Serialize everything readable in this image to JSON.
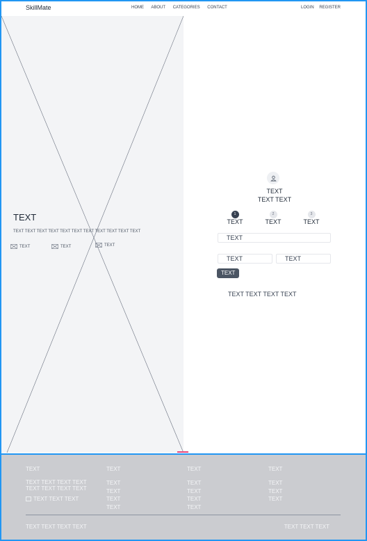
{
  "nav": {
    "brand": "SkillMate",
    "links": [
      "HOME",
      "ABOUT",
      "CATEGORIES",
      "CONTACT"
    ],
    "login": "LOGIN",
    "register": "REGISTER"
  },
  "hero": {
    "title": "TEXT",
    "subtitle": "TEXT TEXT TEXT TEXT TEXT TEXT TEXT TEXT TEXT TEXT TEXT",
    "features": [
      "TEXT",
      "TEXT",
      "TEXT"
    ]
  },
  "panel": {
    "title_line1": "TEXT",
    "title_line2": "TEXT TEXT",
    "steps": [
      {
        "num": "1",
        "label": "TEXT",
        "active": true
      },
      {
        "num": "2",
        "label": "TEXT",
        "active": false
      },
      {
        "num": "3",
        "label": "TEXT",
        "active": false
      }
    ],
    "field_full": "TEXT",
    "field_left": "TEXT",
    "field_right": "TEXT",
    "button": "TEXT",
    "bottom_text": "TEXT TEXT TEXT TEXT"
  },
  "footer": {
    "col1": {
      "heading": "TEXT",
      "desc": "TEXT TEXT TEXT TEXT TEXT TEXT TEXT TEXT",
      "sub": "TEXT TEXT TEXT"
    },
    "col2": {
      "heading": "TEXT",
      "links": [
        "TEXT",
        "TEXT",
        "TEXT",
        "TEXT"
      ]
    },
    "col3": {
      "heading": "TEXT",
      "links": [
        "TEXT",
        "TEXT",
        "TEXT",
        "TEXT"
      ]
    },
    "col4": {
      "heading": "TEXT",
      "links": [
        "TEXT",
        "TEXT",
        "TEXT"
      ]
    },
    "copyright": "TEXT TEXT TEXT TEXT",
    "bottom_right": "TEXT TEXT TEXT"
  },
  "colors": {
    "accent_border": "#2196f3",
    "button": "#4b5563",
    "footer_bg": "#cbccd0"
  }
}
